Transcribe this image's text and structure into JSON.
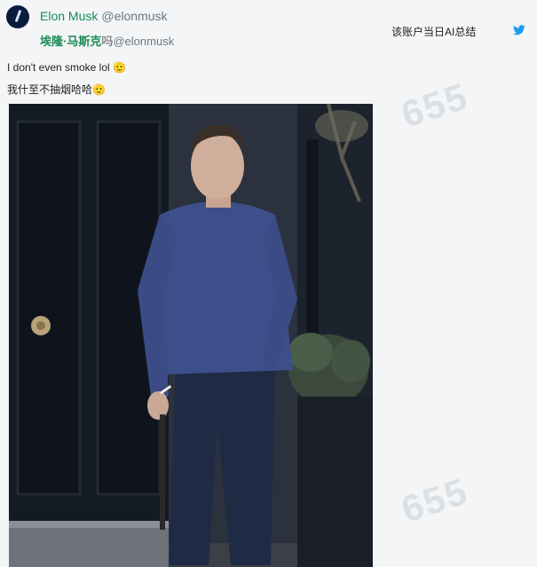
{
  "tweet": {
    "display_name": "Elon Musk",
    "handle": "@elonmusk",
    "translated_name": "埃隆·马斯克",
    "translated_name_suffix": "吗",
    "translated_handle": "@elonmusk",
    "summary_link": "该账户当日AI总结",
    "text_original": "I don't even smoke lol 🫡",
    "text_translated": "我什至不抽烟哈哈🫡"
  },
  "watermark": {
    "text": "655"
  },
  "icons": {
    "avatar": "avatar-image",
    "platform": "twitter-bird-icon"
  },
  "colors": {
    "name_green": "#1b8a55",
    "twitter_blue": "#1d9bf0",
    "background": "#f3f5f7"
  }
}
